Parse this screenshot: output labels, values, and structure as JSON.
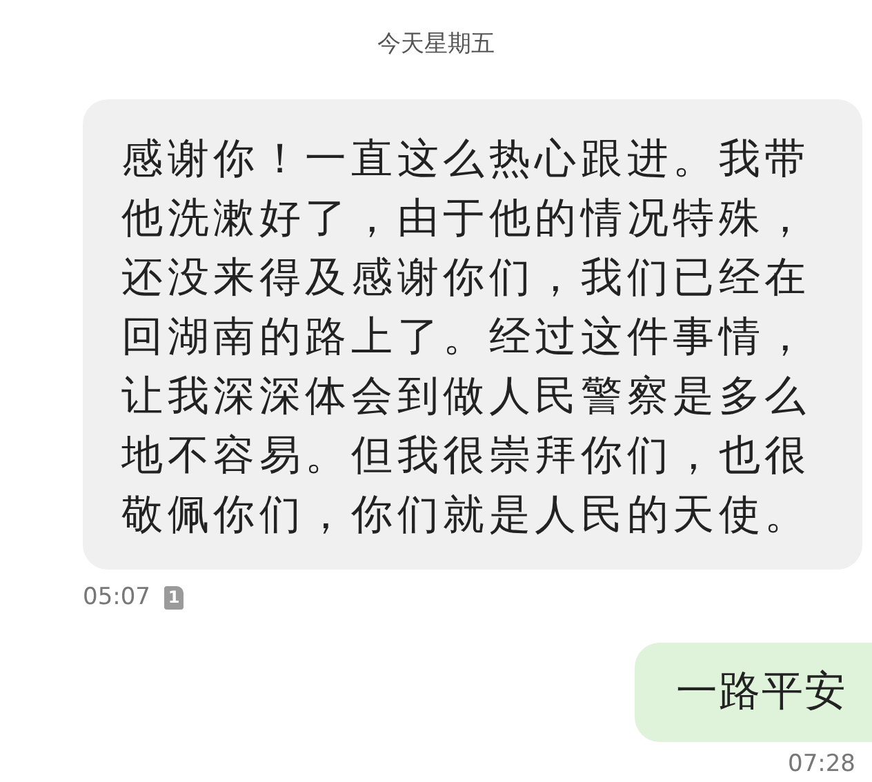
{
  "date_header": "今天星期五",
  "messages": [
    {
      "kind": "incoming",
      "text": "感谢你！一直这么热心跟进。我带他洗漱好了，由于他的情况特殊，还没来得及感谢你们，我们已经在回湖南的路上了。经过这件事情，让我深深体会到做人民警察是多么地不容易。但我很崇拜你们，也很敬佩你们，你们就是人民的天使。",
      "time": "05:07",
      "sim": "1"
    },
    {
      "kind": "outgoing",
      "text": "一路平安",
      "time": "07:28"
    }
  ]
}
